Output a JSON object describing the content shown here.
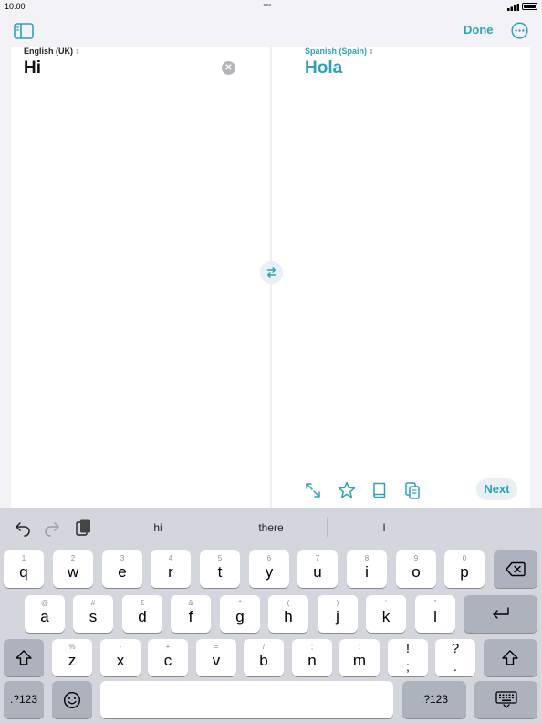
{
  "status": {
    "time": "10:00",
    "dots": "•••"
  },
  "nav": {
    "done_label": "Done"
  },
  "translation": {
    "source_language": "English (UK)",
    "target_language": "Spanish (Spain)",
    "source_text": "Hi",
    "target_text": "Hola",
    "lang_chevron": "⌃⌄"
  },
  "actions": {
    "next_label": "Next"
  },
  "keyboard": {
    "suggestions": [
      "hi",
      "there",
      "I"
    ],
    "row1": [
      {
        "main": "q",
        "sub": "1"
      },
      {
        "main": "w",
        "sub": "2"
      },
      {
        "main": "e",
        "sub": "3"
      },
      {
        "main": "r",
        "sub": "4"
      },
      {
        "main": "t",
        "sub": "5"
      },
      {
        "main": "y",
        "sub": "6"
      },
      {
        "main": "u",
        "sub": "7"
      },
      {
        "main": "i",
        "sub": "8"
      },
      {
        "main": "o",
        "sub": "9"
      },
      {
        "main": "p",
        "sub": "0"
      }
    ],
    "row2": [
      {
        "main": "a",
        "sub": "@"
      },
      {
        "main": "s",
        "sub": "#"
      },
      {
        "main": "d",
        "sub": "£"
      },
      {
        "main": "f",
        "sub": "&"
      },
      {
        "main": "g",
        "sub": "*"
      },
      {
        "main": "h",
        "sub": "("
      },
      {
        "main": "j",
        "sub": ")"
      },
      {
        "main": "k",
        "sub": "'"
      },
      {
        "main": "l",
        "sub": "\""
      }
    ],
    "row3": [
      {
        "main": "z",
        "sub": "%"
      },
      {
        "main": "x",
        "sub": "-"
      },
      {
        "main": "c",
        "sub": "+"
      },
      {
        "main": "v",
        "sub": "="
      },
      {
        "main": "b",
        "sub": "/"
      },
      {
        "main": "n",
        "sub": ";"
      },
      {
        "main": "m",
        "sub": ":"
      },
      {
        "main": ";",
        "sub": "!"
      },
      {
        "main": ".",
        "sub": "?"
      }
    ],
    "numbers_label": ".?123"
  },
  "colors": {
    "accent": "#2aa3b7",
    "keyboard_bg": "#d3d6dc",
    "key_dark": "#adb3bc"
  },
  "icons": {
    "sidebar": "sidebar-icon",
    "more": "ellipsis-circle-icon",
    "clear": "xmark-circle-icon",
    "swap": "swap-arrows-icon",
    "expand": "expand-icon",
    "favorite": "star-icon",
    "dictionary": "book-icon",
    "copy": "copy-icon",
    "undo": "undo-icon",
    "redo": "redo-icon",
    "paste": "clipboard-icon",
    "delete": "delete-backward-icon",
    "return": "return-icon",
    "shift": "shift-icon",
    "emoji": "emoji-icon",
    "dismiss_keyboard": "keyboard-dismiss-icon"
  }
}
